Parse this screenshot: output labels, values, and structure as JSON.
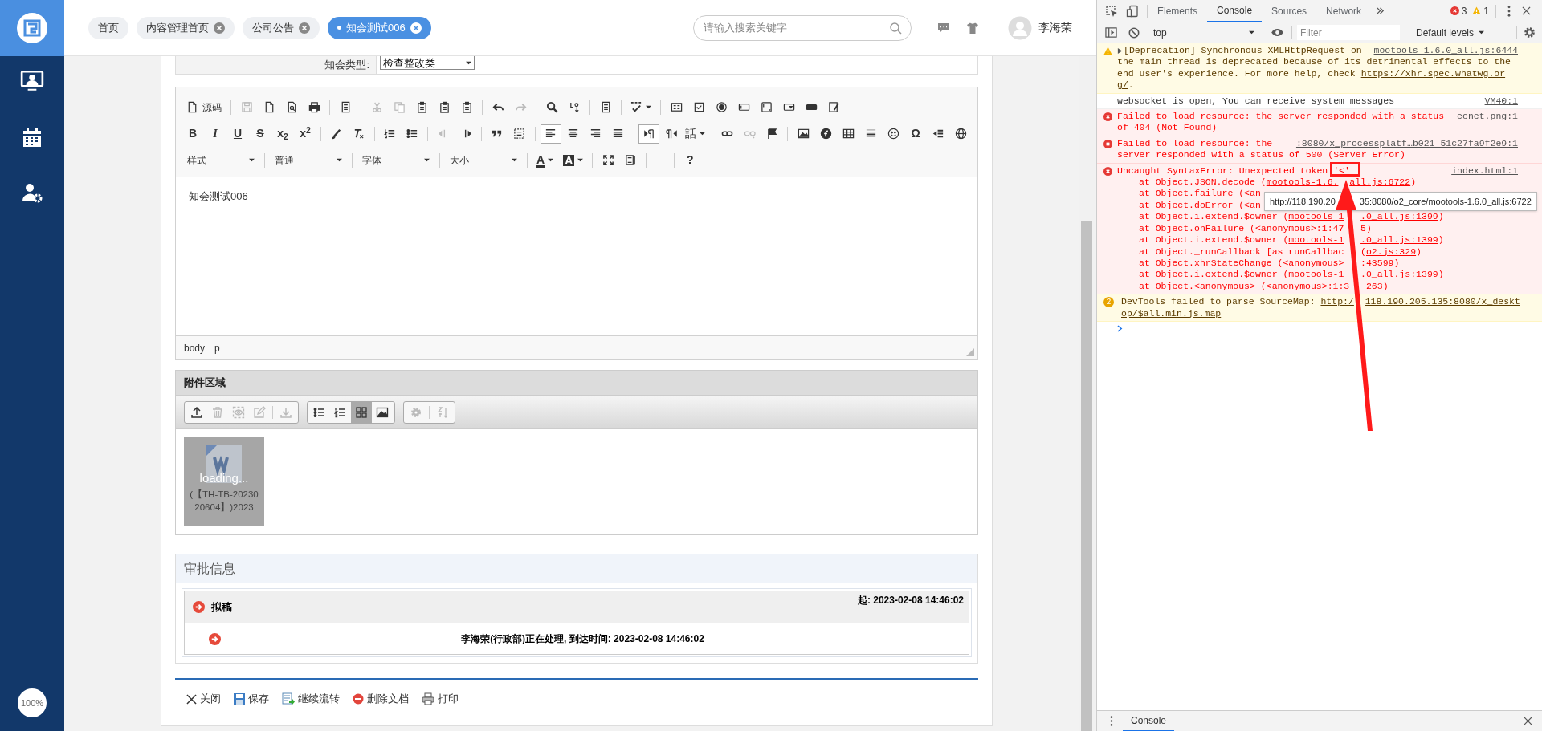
{
  "sidebar": {
    "zoom_level": "100%"
  },
  "top_bar": {
    "tabs": [
      {
        "label": "首页",
        "closable": false,
        "selected": false
      },
      {
        "label": "内容管理首页",
        "closable": true,
        "selected": false
      },
      {
        "label": "公司公告",
        "closable": true,
        "selected": false
      },
      {
        "label": "知会测试006",
        "closable": true,
        "selected": true
      }
    ],
    "search": {
      "placeholder": "请输入搜索关键字"
    },
    "user": "李海荣"
  },
  "form": {
    "label": "知会类型:",
    "value": "检查整改类"
  },
  "editor": {
    "toolbar": [
      [
        {
          "kind": "button",
          "label": "源码",
          "disabled": false,
          "selected": false
        },
        {
          "kind": "separator"
        },
        {
          "kind": "button",
          "disabled": true,
          "selected": false
        },
        {
          "kind": "button",
          "disabled": false,
          "selected": false
        },
        {
          "kind": "button",
          "disabled": false,
          "selected": false
        },
        {
          "kind": "button",
          "disabled": false,
          "selected": false
        },
        {
          "kind": "separator"
        },
        {
          "kind": "button",
          "disabled": false,
          "selected": false
        },
        {
          "kind": "separator"
        },
        {
          "kind": "button",
          "disabled": true,
          "selected": false
        },
        {
          "kind": "button",
          "disabled": true,
          "selected": false
        },
        {
          "kind": "button",
          "disabled": false,
          "selected": false
        },
        {
          "kind": "button",
          "disabled": false,
          "selected": false
        },
        {
          "kind": "button",
          "disabled": false,
          "selected": false
        },
        {
          "kind": "separator"
        },
        {
          "kind": "button",
          "disabled": false,
          "selected": false
        },
        {
          "kind": "button",
          "disabled": true,
          "selected": false
        },
        {
          "kind": "separator"
        },
        {
          "kind": "button",
          "disabled": false,
          "selected": false
        },
        {
          "kind": "button",
          "disabled": false,
          "selected": false
        },
        {
          "kind": "separator"
        },
        {
          "kind": "button",
          "disabled": false,
          "selected": false
        },
        {
          "kind": "separator"
        },
        {
          "kind": "button",
          "caret": true,
          "disabled": false,
          "selected": false
        },
        {
          "kind": "separator"
        },
        {
          "kind": "button",
          "disabled": false,
          "selected": false
        },
        {
          "kind": "button",
          "disabled": false,
          "selected": false
        },
        {
          "kind": "button",
          "disabled": false,
          "selected": false
        },
        {
          "kind": "button",
          "disabled": false,
          "selected": false
        },
        {
          "kind": "button",
          "disabled": false,
          "selected": false
        },
        {
          "kind": "button",
          "disabled": false,
          "selected": false
        },
        {
          "kind": "button",
          "disabled": false,
          "selected": false
        },
        {
          "kind": "button",
          "disabled": false,
          "selected": false
        }
      ],
      [
        {
          "kind": "text",
          "text": "B",
          "disabled": false,
          "selected": false
        },
        {
          "kind": "text",
          "text": "I",
          "disabled": false,
          "selected": false
        },
        {
          "kind": "text",
          "text": "U",
          "disabled": false,
          "selected": false
        },
        {
          "kind": "text",
          "text": "S",
          "disabled": false,
          "selected": false
        },
        {
          "kind": "text",
          "text": "x$_{2}$",
          "disabled": false,
          "selected": false
        },
        {
          "kind": "text",
          "text": "x$^{2}$",
          "disabled": false,
          "selected": false
        },
        {
          "kind": "separator"
        },
        {
          "kind": "button",
          "disabled": false,
          "selected": false
        },
        {
          "kind": "button",
          "disabled": false,
          "selected": false
        },
        {
          "kind": "separator"
        },
        {
          "kind": "button",
          "disabled": false,
          "selected": false
        },
        {
          "kind": "button",
          "disabled": false,
          "selected": false
        },
        {
          "kind": "separator"
        },
        {
          "kind": "button",
          "disabled": true,
          "selected": false
        },
        {
          "kind": "button",
          "disabled": false,
          "selected": false
        },
        {
          "kind": "separator"
        },
        {
          "kind": "button",
          "disabled": false,
          "selected": false
        },
        {
          "kind": "button",
          "disabled": false,
          "selected": false
        },
        {
          "kind": "separator"
        },
        {
          "kind": "button",
          "disabled": false,
          "selected": true
        },
        {
          "kind": "button",
          "disabled": false,
          "selected": false
        },
        {
          "kind": "button",
          "disabled": false,
          "selected": false
        },
        {
          "kind": "button",
          "disabled": false,
          "selected": false
        },
        {
          "kind": "separator"
        },
        {
          "kind": "button",
          "disabled": false,
          "selected": true
        },
        {
          "kind": "button",
          "disabled": false,
          "selected": false
        },
        {
          "kind": "text",
          "text": "話",
          "caret": true,
          "disabled": false,
          "selected": false
        },
        {
          "kind": "separator"
        },
        {
          "kind": "button",
          "disabled": false,
          "selected": false
        },
        {
          "kind": "button",
          "disabled": true,
          "selected": false
        },
        {
          "kind": "button",
          "disabled": false,
          "selected": false
        },
        {
          "kind": "separator"
        },
        {
          "kind": "button",
          "disabled": false,
          "selected": false
        },
        {
          "kind": "button",
          "disabled": false,
          "selected": false
        },
        {
          "kind": "button",
          "disabled": false,
          "selected": false
        },
        {
          "kind": "button",
          "disabled": false,
          "selected": false
        },
        {
          "kind": "button",
          "disabled": false,
          "selected": false
        },
        {
          "kind": "text",
          "text": "Ω",
          "disabled": false,
          "selected": false
        },
        {
          "kind": "button",
          "disabled": false,
          "selected": false
        },
        {
          "kind": "button",
          "disabled": false,
          "selected": false
        }
      ],
      [
        {
          "kind": "dropdown",
          "label": "样式"
        },
        {
          "kind": "separator"
        },
        {
          "kind": "dropdown",
          "label": "普通"
        },
        {
          "kind": "separator"
        },
        {
          "kind": "dropdown",
          "label": "字体"
        },
        {
          "kind": "separator"
        },
        {
          "kind": "dropdown",
          "label": "大小"
        },
        {
          "kind": "separator"
        },
        {
          "kind": "text",
          "text": "A",
          "caret": true,
          "disabled": false,
          "selected": false
        },
        {
          "kind": "text",
          "text": "A",
          "caret": true,
          "disabled": false,
          "selected": false
        },
        {
          "kind": "separator"
        },
        {
          "kind": "button",
          "disabled": false,
          "selected": false
        },
        {
          "kind": "button",
          "disabled": false,
          "selected": false
        },
        {
          "kind": "separator"
        },
        {
          "kind": "spacer"
        },
        {
          "kind": "separator"
        },
        {
          "kind": "text",
          "text": "?",
          "disabled": false,
          "selected": false
        }
      ]
    ],
    "content": "知会测试006",
    "path": [
      "body",
      "p"
    ]
  },
  "attachments": {
    "title": "附件区域",
    "toolbar": [
      [
        {
          "kind": "button",
          "disabled": false,
          "selected": false
        },
        {
          "kind": "button",
          "disabled": true,
          "selected": false
        },
        {
          "kind": "button",
          "disabled": true,
          "selected": false
        },
        {
          "kind": "button",
          "disabled": true,
          "selected": false
        },
        {
          "kind": "separator"
        },
        {
          "kind": "button",
          "disabled": true,
          "selected": false
        }
      ],
      [
        {
          "kind": "button",
          "disabled": false,
          "selected": false
        },
        {
          "kind": "button",
          "disabled": false,
          "selected": false
        },
        {
          "kind": "button",
          "disabled": false,
          "selected": true
        },
        {
          "kind": "button",
          "disabled": false,
          "selected": false
        }
      ],
      [
        {
          "kind": "button",
          "disabled": true,
          "selected": false
        },
        {
          "kind": "separator"
        },
        {
          "kind": "button",
          "disabled": true,
          "selected": false
        }
      ]
    ],
    "files": [
      {
        "status": "loading...",
        "name": "(【TH-TB-2023020604】)2023"
      }
    ]
  },
  "approval": {
    "title": "审批信息",
    "steps": [
      {
        "name": "拟稿",
        "start": "起: 2023-02-08 14:46:02",
        "records": [
          "李海荣(行政部)正在处理, 到达时间: 2023-02-08 14:46:02"
        ]
      }
    ]
  },
  "actions": [
    {
      "label": "关闭"
    },
    {
      "label": "保存"
    },
    {
      "label": "继续流转"
    },
    {
      "label": "删除文档"
    },
    {
      "label": "打印"
    }
  ],
  "devtools": {
    "tabs": [
      {
        "label": "Elements",
        "selected": false
      },
      {
        "label": "Console",
        "selected": true
      },
      {
        "label": "Sources",
        "selected": false
      },
      {
        "label": "Network",
        "selected": false
      }
    ],
    "error_count": "3",
    "warning_count": "1",
    "context": "top",
    "filter_placeholder": "Filter",
    "levels": "Default levels",
    "messages": [
      {
        "kind": "warning",
        "expanded": false,
        "source": "mootools-1.6.0_all.js:6444",
        "lines": [
          {
            "parts": [
              {
                "text": "[Deprecation] Synchronous XMLHttpRequest on"
              }
            ]
          },
          {
            "parts": [
              {
                "text": "the main thread is deprecated because of its detrimental effects to the"
              }
            ]
          },
          {
            "parts": [
              {
                "text": "end user's experience. For more help, check "
              },
              {
                "text": "https://xhr.spec.whatwg.or",
                "link": true
              }
            ]
          },
          {
            "parts": [
              {
                "text": "g/",
                "link": true
              },
              {
                "text": "."
              }
            ]
          }
        ]
      },
      {
        "kind": "info",
        "source": "VM40:1",
        "lines": [
          {
            "parts": [
              {
                "text": "websocket is open, You can receive system messages"
              }
            ]
          }
        ]
      },
      {
        "kind": "error",
        "source": "ecnet.png:1",
        "lines": [
          {
            "parts": [
              {
                "text": "Failed to load resource: the server responded with a status"
              }
            ]
          },
          {
            "parts": [
              {
                "text": "of 404 (Not Found)"
              }
            ]
          }
        ]
      },
      {
        "kind": "error",
        "source": ":8080/x_processplatf…b021-51c27fa9f2e9:1",
        "lines": [
          {
            "parts": [
              {
                "text": "Failed to load resource: the"
              }
            ]
          },
          {
            "parts": [
              {
                "text": "server responded with a status of 500 (Server Error)"
              }
            ]
          }
        ]
      },
      {
        "kind": "error",
        "source": "index.html:1",
        "lines": [
          {
            "parts": [
              {
                "text": "Uncaught SyntaxError: Unexpected token "
              },
              {
                "text": "'<'"
              }
            ]
          }
        ],
        "stack": [
          {
            "parts": [
              {
                "text": "at Object.JSON.decode ("
              },
              {
                "text": "mootools-1.6.",
                "link": true
              }
            ],
            "after": [
              {
                "text": "all.js:6722",
                "link": true
              },
              {
                "text": ")"
              }
            ]
          },
          {
            "parts": [
              {
                "text": "at Object.failure (<an"
              }
            ]
          },
          {
            "parts": [
              {
                "text": "at Object.doError (<an"
              }
            ]
          },
          {
            "parts": [
              {
                "text": "at Object.i.extend.$owner ("
              },
              {
                "text": "mootools-1",
                "link": true
              }
            ],
            "after": [
              {
                "text": ".0_all.js:1399",
                "link": true
              },
              {
                "text": ")"
              }
            ]
          },
          {
            "parts": [
              {
                "text": "at Object.onFailure (<anonymous>:1:47"
              }
            ],
            "after": [
              {
                "text": "5)"
              }
            ]
          },
          {
            "parts": [
              {
                "text": "at Object.i.extend.$owner ("
              },
              {
                "text": "mootools-1",
                "link": true
              }
            ],
            "after": [
              {
                "text": ".0_all.js:1399",
                "link": true
              },
              {
                "text": ")"
              }
            ]
          },
          {
            "parts": [
              {
                "text": "at Object._runCallback [as runCallbac"
              }
            ],
            "after": [
              {
                "text": "("
              },
              {
                "text": "o2.js:329",
                "link": true
              },
              {
                "text": ")"
              }
            ]
          },
          {
            "parts": [
              {
                "text": "at Object.xhrStateChange (<anonymous>"
              }
            ],
            "after": [
              {
                "text": ":43599)"
              }
            ]
          },
          {
            "parts": [
              {
                "text": "at Object.i.extend.$owner ("
              },
              {
                "text": "mootools-1",
                "link": true
              }
            ],
            "after": [
              {
                "text": ".0_all.js:1399",
                "link": true
              },
              {
                "text": ")"
              }
            ]
          },
          {
            "parts": [
              {
                "text": "at Object.<anonymous> (<anonymous>:1:3"
              }
            ],
            "after": [
              {
                "text": "263)"
              }
            ]
          }
        ]
      },
      {
        "kind": "warning",
        "count": "2",
        "lines": [
          {
            "parts": [
              {
                "text": "DevTools failed to parse SourceMap: "
              },
              {
                "text": "http:/",
                "link": true
              }
            ],
            "after": [
              {
                "text": "118.190.205.135:8080/x_deskt",
                "link": true
              }
            ]
          },
          {
            "parts": [
              {
                "text": "op/$all.min.js.map",
                "link": true
              }
            ]
          }
        ]
      }
    ],
    "tooltip": {
      "before": "http://118.190.20",
      "after": "35:8080/o2_core/mootools-1.6.0_all.js:6722"
    },
    "drawer_tabs": [
      {
        "label": "Console",
        "selected": true
      }
    ]
  }
}
